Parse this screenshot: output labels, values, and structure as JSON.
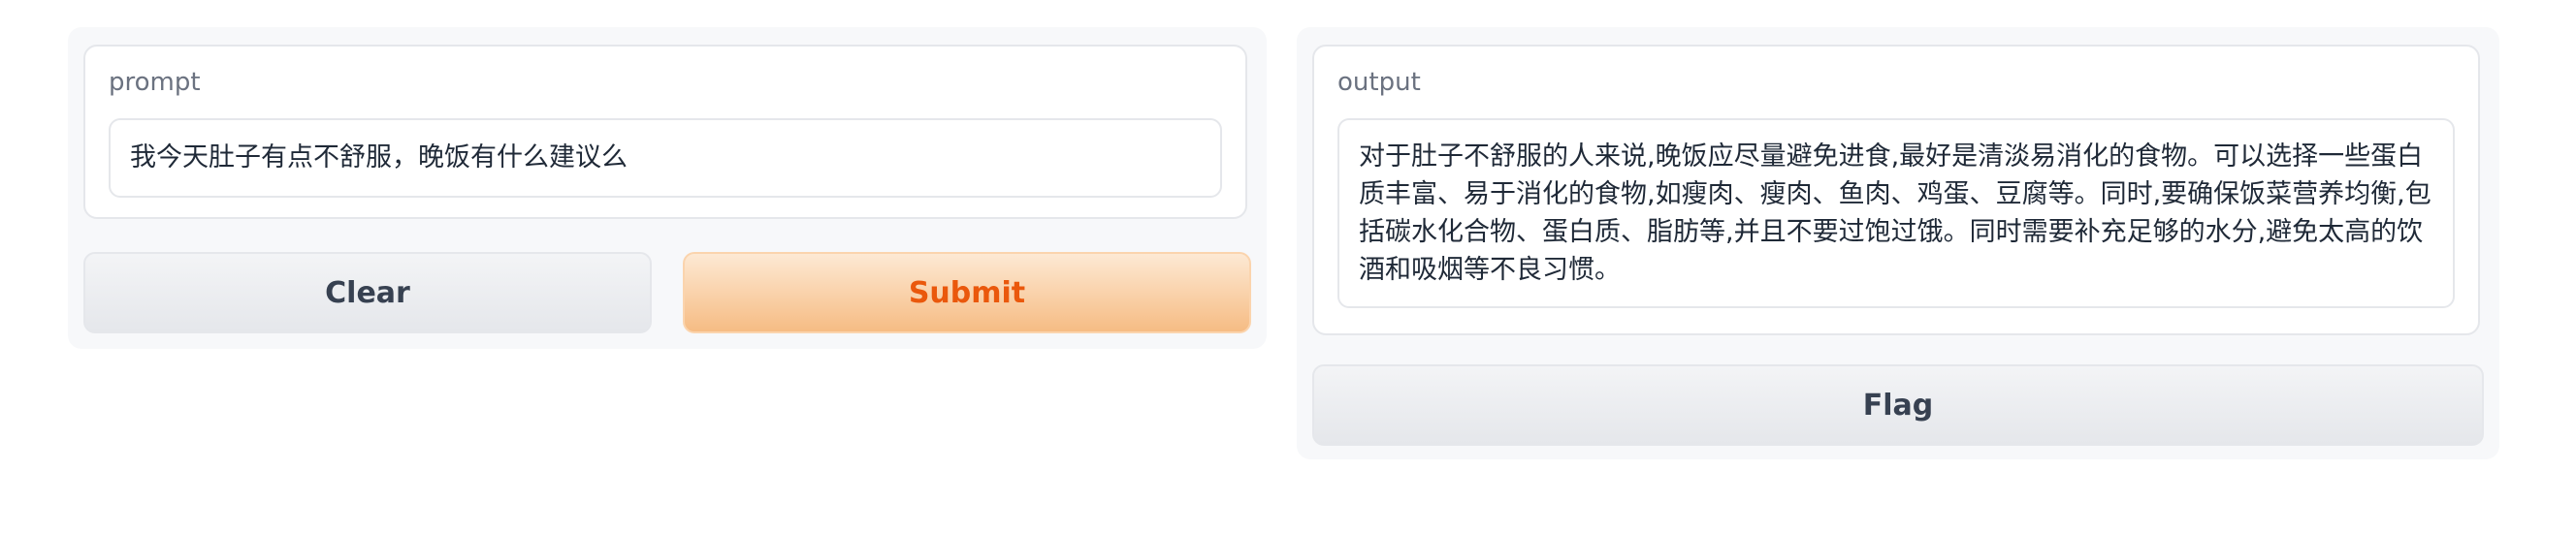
{
  "input": {
    "label": "prompt",
    "value": "我今天肚子有点不舒服，晚饭有什么建议么"
  },
  "buttons": {
    "clear": "Clear",
    "submit": "Submit",
    "flag": "Flag"
  },
  "output": {
    "label": "output",
    "value": "对于肚子不舒服的人来说,晚饭应尽量避免进食,最好是清淡易消化的食物。可以选择一些蛋白质丰富、易于消化的食物,如瘦肉、瘦肉、鱼肉、鸡蛋、豆腐等。同时,要确保饭菜营养均衡,包括碳水化合物、蛋白质、脂肪等,并且不要过饱过饿。同时需要补充足够的水分,避免太高的饮酒和吸烟等不良习惯。"
  },
  "colors": {
    "primary_text": "#ea580c",
    "primary_bg": "#f6bc84",
    "panel_bg": "#f7f8fa"
  }
}
